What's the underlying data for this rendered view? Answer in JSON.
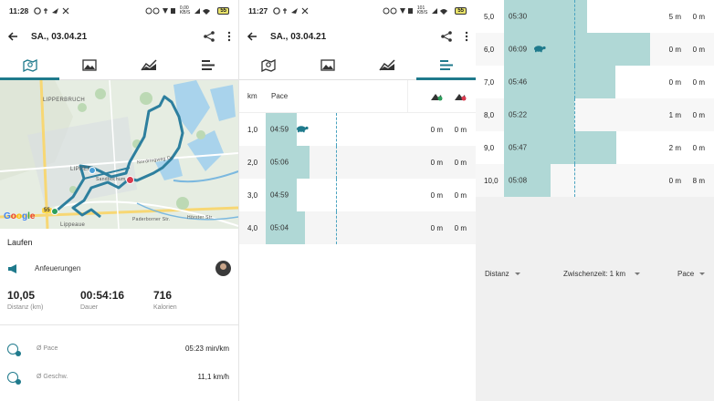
{
  "panel1": {
    "status": {
      "time": "11:28",
      "net": "0,00\nKB/S",
      "battery": "55"
    },
    "title": "SA., 03.04.21",
    "map": {
      "places": [
        "LIPPERBRUCH",
        "LIPPER",
        "Lippeaue"
      ],
      "roads": [
        "Nordringweg Dr",
        "Sandbochum",
        "Paderborner Str.",
        "Hörster Str."
      ],
      "road_badge": "55",
      "google": "Google"
    },
    "activity": "Laufen",
    "cheer_label": "Anfeuerungen",
    "stats": [
      {
        "value": "10,05",
        "label": "Distanz (km)"
      },
      {
        "value": "00:54:16",
        "label": "Dauer"
      },
      {
        "value": "716",
        "label": "Kalorien"
      }
    ],
    "avg_pace": {
      "label": "Ø Pace",
      "value": "05:23 min/km"
    },
    "avg_speed": {
      "label": "Ø Geschw.",
      "value": "11,1 km/h"
    }
  },
  "panel2": {
    "status": {
      "time": "11:27",
      "net": "101\nKB/S",
      "battery": "55"
    },
    "title": "SA., 03.04.21",
    "header": {
      "km": "km",
      "pace": "Pace"
    },
    "rows": [
      {
        "km": "1,0",
        "pace": "04:59",
        "up": "0 m",
        "down": "0 m",
        "pace_frac": 0.21,
        "turtle": true
      },
      {
        "km": "2,0",
        "pace": "05:06",
        "up": "0 m",
        "down": "0 m",
        "pace_frac": 0.3,
        "turtle": false
      },
      {
        "km": "3,0",
        "pace": "04:59",
        "up": "0 m",
        "down": "0 m",
        "pace_frac": 0.21,
        "turtle": false
      },
      {
        "km": "4,0",
        "pace": "05:04",
        "up": "0 m",
        "down": "0 m",
        "pace_frac": 0.27,
        "turtle": false
      }
    ]
  },
  "panel3": {
    "rows": [
      {
        "km": "5,0",
        "pace": "05:30",
        "up": "5 m",
        "down": "0 m",
        "pace_frac": 0.57,
        "turtle": false
      },
      {
        "km": "6,0",
        "pace": "06:09",
        "up": "0 m",
        "down": "0 m",
        "pace_frac": 1.0,
        "turtle": true
      },
      {
        "km": "7,0",
        "pace": "05:46",
        "up": "0 m",
        "down": "0 m",
        "pace_frac": 0.76,
        "turtle": false
      },
      {
        "km": "8,0",
        "pace": "05:22",
        "up": "1 m",
        "down": "0 m",
        "pace_frac": 0.48,
        "turtle": false
      },
      {
        "km": "9,0",
        "pace": "05:47",
        "up": "2 m",
        "down": "0 m",
        "pace_frac": 0.77,
        "turtle": false
      },
      {
        "km": "10,0",
        "pace": "05:08",
        "up": "0 m",
        "down": "8 m",
        "pace_frac": 0.32,
        "turtle": false
      }
    ],
    "footer": {
      "left": "Distanz",
      "center": "Zwischenzeit: 1 km",
      "right": "Pace"
    }
  },
  "colors": {
    "accent": "#1f7a8c",
    "bar": "#b0d8d6",
    "route": "#2d7f9e",
    "dash": "#4aa3c0"
  }
}
